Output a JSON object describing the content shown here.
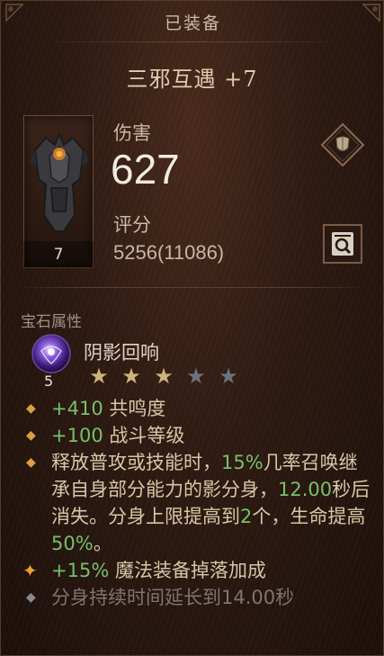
{
  "header": {
    "title": "已装备"
  },
  "item": {
    "name": "三邪互遇 +7",
    "level": "7"
  },
  "stats": {
    "damage_label": "伤害",
    "damage_value": "627",
    "score_label": "评分",
    "score_value": "5256(11086)"
  },
  "gem": {
    "section_title": "宝石属性",
    "name": "阴影回响",
    "rank": "5",
    "stars_filled": 3,
    "stars_total": 5
  },
  "properties": [
    {
      "parts": [
        {
          "t": "+410",
          "c": "num"
        },
        {
          "t": " 共鸣度",
          "c": ""
        }
      ]
    },
    {
      "parts": [
        {
          "t": "+100",
          "c": "num"
        },
        {
          "t": " 战斗等级",
          "c": ""
        }
      ]
    },
    {
      "parts": [
        {
          "t": "释放普攻或技能时，",
          "c": ""
        },
        {
          "t": "15%",
          "c": "num"
        },
        {
          "t": "几率召唤继承自身部分能力的影分身，",
          "c": ""
        },
        {
          "t": "12.00",
          "c": "num"
        },
        {
          "t": "秒后消失。分身上限提高到",
          "c": ""
        },
        {
          "t": "2",
          "c": "num"
        },
        {
          "t": "个，生命提高",
          "c": ""
        },
        {
          "t": "50%",
          "c": "num"
        },
        {
          "t": "。",
          "c": ""
        }
      ]
    },
    {
      "style": "big-bullet",
      "parts": [
        {
          "t": "+15%",
          "c": "num"
        },
        {
          "t": " 魔法装备掉落加成",
          "c": ""
        }
      ]
    },
    {
      "style": "dim",
      "parts": [
        {
          "t": "分身持续时间延长到14.00秒",
          "c": ""
        }
      ]
    }
  ],
  "colors": {
    "accent_green": "#77c06a",
    "bullet_gold": "#d8a040",
    "star_gold": "#cdb47a",
    "star_grey": "#6a7480"
  },
  "icons": {
    "header_ornament": "corner-ornament-icon",
    "item": "armor-chestplate-icon",
    "compare": "shield-diamond-icon",
    "inspect": "magnifier-icon",
    "gem": "shadow-echo-gem-icon",
    "bullet": "diamond-bullet-icon"
  }
}
